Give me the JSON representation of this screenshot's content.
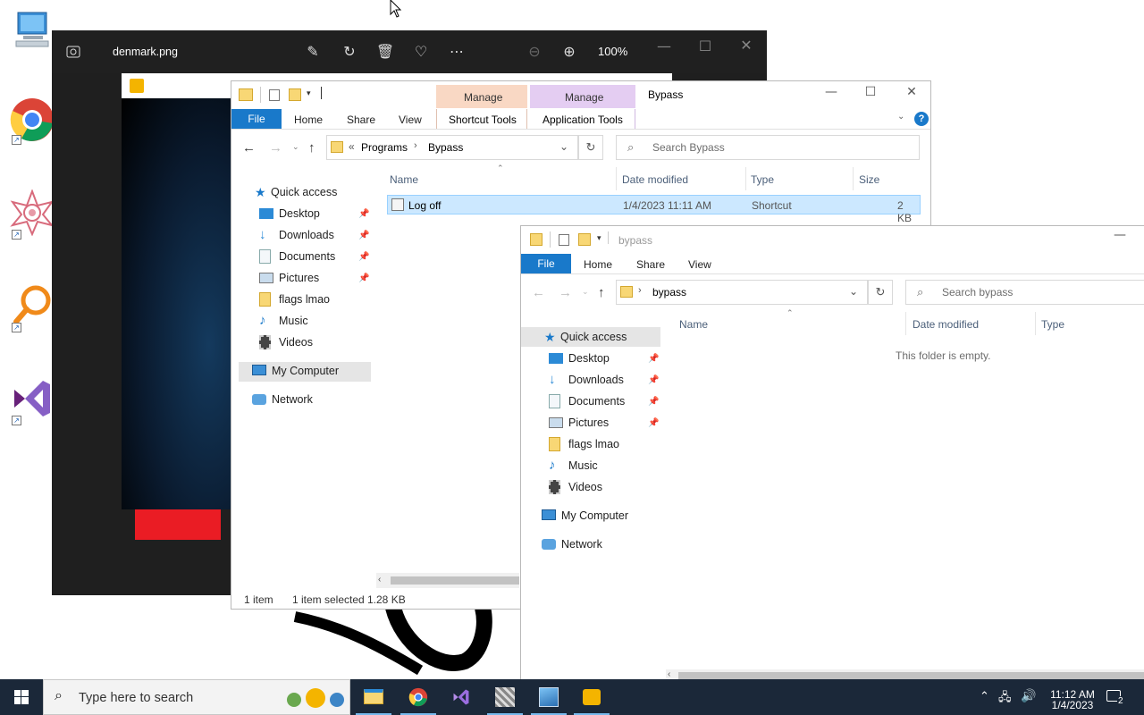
{
  "photos": {
    "filename": "denmark.png",
    "zoom": "100%"
  },
  "explorer1": {
    "title": "Bypass",
    "context_tabs": [
      {
        "header": "Manage",
        "label": "Shortcut Tools",
        "color": "#f9d8c4"
      },
      {
        "header": "Manage",
        "label": "Application Tools",
        "color": "#e4cdf2"
      }
    ],
    "ribbon_tabs": [
      "File",
      "Home",
      "Share",
      "View"
    ],
    "breadcrumb": {
      "prefix": "«",
      "parts": [
        "Programs",
        "Bypass"
      ]
    },
    "search_placeholder": "Search Bypass",
    "columns": [
      "Name",
      "Date modified",
      "Type",
      "Size"
    ],
    "files": [
      {
        "name": "Log off",
        "date": "1/4/2023 11:11 AM",
        "type": "Shortcut",
        "size": "2 KB"
      }
    ],
    "nav": {
      "quick_access": "Quick access",
      "items": [
        {
          "label": "Desktop",
          "icon": "desktop-icon",
          "pinned": true
        },
        {
          "label": "Downloads",
          "icon": "downloads-icon",
          "pinned": true
        },
        {
          "label": "Documents",
          "icon": "documents-icon",
          "pinned": true
        },
        {
          "label": "Pictures",
          "icon": "pictures-icon",
          "pinned": true
        },
        {
          "label": "flags lmao",
          "icon": "folder-icon",
          "pinned": false
        },
        {
          "label": "Music",
          "icon": "music-icon",
          "pinned": false
        },
        {
          "label": "Videos",
          "icon": "videos-icon",
          "pinned": false
        }
      ],
      "my_computer": "My Computer",
      "network": "Network"
    },
    "status": {
      "count": "1 item",
      "selected": "1 item selected",
      "size": "1.28 KB"
    }
  },
  "explorer2": {
    "title": "bypass",
    "ribbon_tabs": [
      "File",
      "Home",
      "Share",
      "View"
    ],
    "breadcrumb": {
      "parts": [
        "bypass"
      ]
    },
    "search_placeholder": "Search bypass",
    "columns": [
      "Name",
      "Date modified",
      "Type"
    ],
    "empty_message": "This folder is empty.",
    "nav": {
      "quick_access": "Quick access",
      "items": [
        {
          "label": "Desktop",
          "pinned": true
        },
        {
          "label": "Downloads",
          "pinned": true
        },
        {
          "label": "Documents",
          "pinned": true
        },
        {
          "label": "Pictures",
          "pinned": true
        },
        {
          "label": "flags lmao",
          "pinned": false
        },
        {
          "label": "Music",
          "pinned": false
        },
        {
          "label": "Videos",
          "pinned": false
        }
      ],
      "my_computer": "My Computer",
      "network": "Network"
    }
  },
  "taskbar": {
    "search_placeholder": "Type here to search",
    "time": "11:12 AM",
    "date": "1/4/2023",
    "notification_count": "2"
  },
  "colors": {
    "accent": "#1979ca",
    "selection": "#cce8ff",
    "taskbar": "#1b2839"
  }
}
